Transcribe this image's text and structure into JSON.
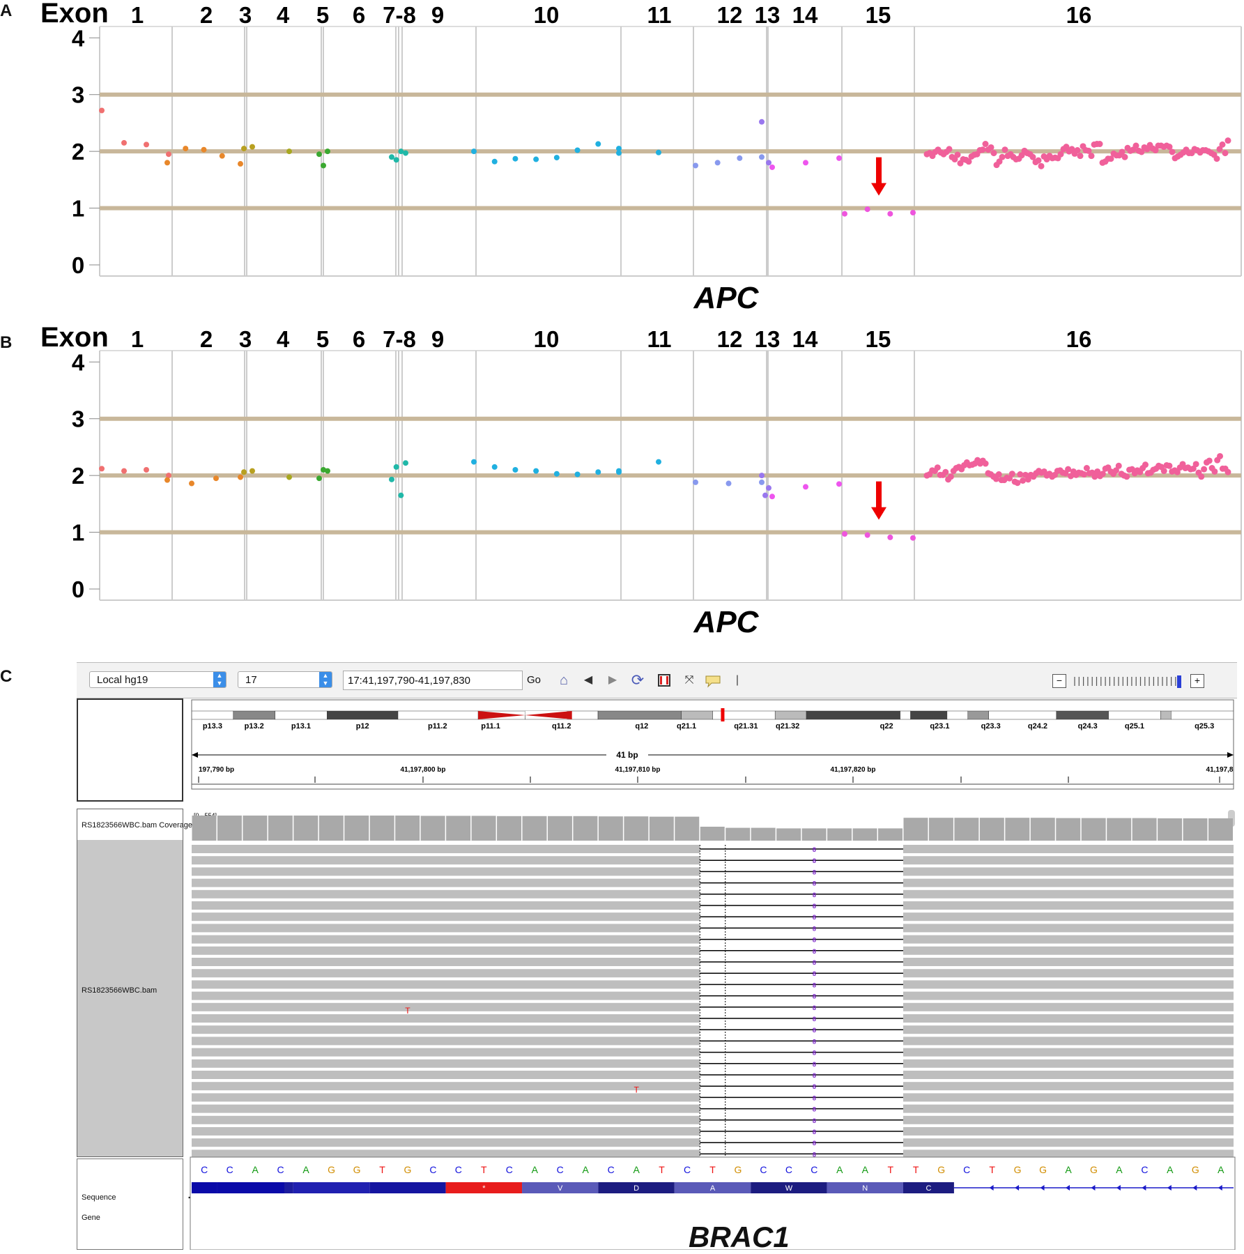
{
  "panels": {
    "A": {
      "label": "A",
      "gene": "APC"
    },
    "B": {
      "label": "B",
      "gene": "APC"
    },
    "C": {
      "label": "C",
      "gene": "BRAC1"
    }
  },
  "exon_header": {
    "word": "Exon",
    "labels": [
      "1",
      "2",
      "3",
      "4",
      "5",
      "6",
      "7-8",
      "9",
      "10",
      "11",
      "12",
      "13",
      "14",
      "15",
      "16"
    ]
  },
  "y_axis_ticks": [
    "4",
    "3",
    "2",
    "1",
    "0"
  ],
  "colors": {
    "reference_line": "#c8b79a",
    "divider": "#cccccc",
    "arrow": "#ee0000",
    "exon_colors": [
      "#f07070",
      "#e8872a",
      "#b8a020",
      "#a8a820",
      "#3aa830",
      "#3aa830",
      "#20b8a8",
      "#20b8a8",
      "#20b0e0",
      "#20b0e0",
      "#8899ee",
      "#9977ee",
      "#ee55ee",
      "#ee55dd",
      "#f0609a"
    ]
  },
  "chart_data": [
    {
      "type": "scatter",
      "panel": "A",
      "xlabel": "APC",
      "ylim": [
        0,
        4.2
      ],
      "reference_lines": [
        1,
        2,
        3
      ],
      "arrow_at_exon": "15",
      "series": [
        {
          "exon": "1",
          "values": [
            2.72,
            2.15,
            2.12,
            1.95
          ]
        },
        {
          "exon": "2",
          "values": [
            1.8,
            2.05,
            2.03,
            1.92,
            1.78
          ]
        },
        {
          "exon": "3",
          "values": [
            2.05,
            2.08
          ]
        },
        {
          "exon": "4",
          "values": [
            2.0
          ]
        },
        {
          "exon": "5",
          "values": [
            1.95,
            1.75,
            2.0
          ]
        },
        {
          "exon": "7-8",
          "values": [
            1.9,
            1.85,
            2.0,
            1.97
          ]
        },
        {
          "exon": "10",
          "values": [
            2.0,
            1.82,
            1.87,
            1.86,
            1.89,
            2.02,
            2.13,
            1.97
          ]
        },
        {
          "exon": "11",
          "values": [
            2.05,
            1.98
          ]
        },
        {
          "exon": "12",
          "values": [
            1.75,
            1.8,
            1.88,
            1.9
          ]
        },
        {
          "exon": "13",
          "values": [
            2.52,
            1.8
          ]
        },
        {
          "exon": "14",
          "values": [
            1.72,
            1.8,
            1.88
          ]
        },
        {
          "exon": "15",
          "values": [
            0.9,
            0.98,
            0.9,
            0.92
          ]
        },
        {
          "exon": "16",
          "values": [
            1.95,
            1.97,
            1.92,
            1.99,
            2.03,
            1.98,
            1.95,
            1.99,
            2.04,
            1.9,
            1.86,
            1.94,
            1.79,
            1.86,
            1.85,
            1.82,
            1.91,
            1.94,
            1.95,
            2.02,
            2.03,
            2.13,
            2.03,
            2.07,
            1.97,
            1.76,
            1.82,
            1.9,
            2.03,
            1.92,
            1.95,
            1.9,
            1.86,
            1.87,
            1.93,
            2.01,
            1.97,
            1.95,
            1.9,
            1.81,
            1.84,
            1.74,
            1.91,
            1.86,
            1.92,
            1.88,
            1.89,
            1.88,
            1.95,
            2.04,
            2.08,
            2.0,
            2.04,
            1.96,
            2.02,
            1.92,
            2.09,
            2.02,
            2.01,
            1.92,
            2.12,
            2.13,
            2.13,
            1.8,
            1.82,
            1.87,
            1.87,
            1.96,
            1.93,
            1.93,
            1.99,
            1.9,
            2.06,
            2.01,
            2.03,
            2.1,
            2.01,
            1.99,
            2.07,
            2.04,
            2.11,
            2.05,
            2.02,
            2.1,
            2.1,
            2.08,
            2.1,
            2.08,
            1.99,
            1.88,
            1.91,
            1.94,
            1.98,
            2.03,
            1.97,
            1.97,
            2.04,
            2.02,
            1.98,
            2.02,
            2.02,
            2.0,
            1.97,
            1.94,
            1.87,
            2.04,
            2.12,
            1.97,
            2.19
          ]
        }
      ]
    },
    {
      "type": "scatter",
      "panel": "B",
      "xlabel": "APC",
      "ylim": [
        0,
        4.2
      ],
      "reference_lines": [
        1,
        2,
        3
      ],
      "arrow_at_exon": "15",
      "series": [
        {
          "exon": "1",
          "values": [
            2.12,
            2.08,
            2.1,
            2.0
          ]
        },
        {
          "exon": "2",
          "values": [
            1.92,
            1.86,
            1.95,
            1.97
          ]
        },
        {
          "exon": "3",
          "values": [
            2.06,
            2.08
          ]
        },
        {
          "exon": "4",
          "values": [
            1.97
          ]
        },
        {
          "exon": "5",
          "values": [
            1.95,
            2.1,
            2.08
          ]
        },
        {
          "exon": "7-8",
          "values": [
            1.93,
            2.15,
            1.65,
            2.22
          ]
        },
        {
          "exon": "10",
          "values": [
            2.24,
            2.15,
            2.1,
            2.08,
            2.03,
            2.02,
            2.06,
            2.06
          ]
        },
        {
          "exon": "11",
          "values": [
            2.08,
            2.24
          ]
        },
        {
          "exon": "12",
          "values": [
            1.88,
            1.86,
            1.88
          ]
        },
        {
          "exon": "13",
          "values": [
            2.0,
            1.65,
            1.78
          ]
        },
        {
          "exon": "14",
          "values": [
            1.63,
            1.8,
            1.85
          ]
        },
        {
          "exon": "15",
          "values": [
            0.97,
            0.95,
            0.91,
            0.9
          ]
        },
        {
          "exon": "16",
          "values": [
            2.0,
            2.02,
            2.09,
            2.08,
            2.14,
            2.01,
            2.01,
            2.06,
            1.93,
            1.98,
            2.08,
            2.13,
            2.15,
            2.11,
            2.18,
            2.23,
            2.18,
            2.19,
            2.21,
            2.27,
            2.21,
            2.26,
            2.21,
            2.04,
            2.02,
            1.98,
            1.94,
            2.02,
            1.92,
            1.92,
            1.96,
            1.95,
            2.03,
            1.89,
            1.87,
            2.02,
            1.91,
            2.01,
            1.93,
            2.01,
            1.98,
            2.04,
            2.08,
            2.05,
            2.07,
            2.0,
            2.03,
            1.98,
            2.01,
            2.08,
            2.09,
            2.05,
            2.04,
            2.11,
            1.99,
            2.07,
            2.01,
            2.05,
            2.04,
            2.02,
            2.13,
            2.04,
            2.05,
            1.98,
            2.07,
            1.99,
            2.03,
            2.12,
            2.14,
            2.07,
            2.03,
            2.09,
            2.17,
            2.03,
            2.0,
            1.98,
            2.1,
            2.11,
            2.04,
            2.09,
            2.06,
            2.13,
            2.19,
            2.04,
            2.05,
            2.1,
            2.12,
            2.17,
            2.15,
            2.08,
            2.18,
            2.17,
            2.07,
            2.09,
            2.06,
            2.14,
            2.2,
            2.13,
            2.14,
            2.11,
            2.12,
            2.2,
            2.05,
            1.98,
            2.11,
            2.23,
            2.26,
            2.13,
            2.07,
            2.27,
            2.34,
            2.12,
            2.12,
            2.06
          ]
        }
      ]
    }
  ],
  "igv": {
    "genome_select": "Local hg19",
    "chromosome_select": "17",
    "locus_value": "17:41,197,790-41,197,830",
    "go_label": "Go",
    "icons": [
      "home-icon",
      "back-icon",
      "forward-icon",
      "refresh-icon",
      "roi-icon",
      "resize-icon",
      "popup-text-icon"
    ],
    "zoom_minus": "−",
    "zoom_plus": "+",
    "cytobands": [
      "p13.3",
      "p13.2",
      "p13.1",
      "p12",
      "p11.2",
      "p11.1",
      "q11.2",
      "q12",
      "q21.1",
      "q21.31",
      "q21.32",
      "q22",
      "q23.1",
      "q23.3",
      "q24.2",
      "q24.3",
      "q25.1",
      "q25.3"
    ],
    "span_label": "41 bp",
    "ruler_labels": [
      "197,790 bp",
      "41,197,800 bp",
      "41,197,810 bp",
      "41,197,820 bp",
      "41,197,8"
    ],
    "coverage_track_name": "RS1823566WBC.bam Coverage",
    "coverage_range": "[0 - 554]",
    "alignment_track_name": "RS1823566WBC.bam",
    "insertion_marker": "8",
    "mismatch_base": "T",
    "sequence_label": "Sequence",
    "gene_label": "Gene",
    "strand_arrow": "➞",
    "sequence": [
      "C",
      "C",
      "A",
      "C",
      "A",
      "G",
      "G",
      "T",
      "G",
      "C",
      "C",
      "T",
      "C",
      "A",
      "C",
      "A",
      "C",
      "A",
      "T",
      "C",
      "T",
      "G",
      "C",
      "C",
      "C",
      "A",
      "A",
      "T",
      "T",
      "G",
      "C",
      "T",
      "G",
      "G",
      "A",
      "G",
      "A",
      "C",
      "A",
      "G",
      "A"
    ],
    "base_colors": {
      "A": "#119911",
      "C": "#1111dd",
      "G": "#d18d00",
      "T": "#ee1111"
    },
    "amino_acids": [
      "",
      "",
      "",
      "",
      "*",
      "V",
      "D",
      "A",
      "W",
      "N",
      "C"
    ],
    "coverage_heights": [
      0.9,
      0.9,
      0.9,
      0.9,
      0.9,
      0.9,
      0.9,
      0.9,
      0.9,
      0.89,
      0.89,
      0.89,
      0.88,
      0.88,
      0.88,
      0.88,
      0.87,
      0.87,
      0.86,
      0.86,
      0.5,
      0.46,
      0.46,
      0.44,
      0.44,
      0.44,
      0.44,
      0.44,
      0.82,
      0.82,
      0.82,
      0.82,
      0.82,
      0.82,
      0.81,
      0.81,
      0.81,
      0.81,
      0.8,
      0.8,
      0.8
    ]
  }
}
